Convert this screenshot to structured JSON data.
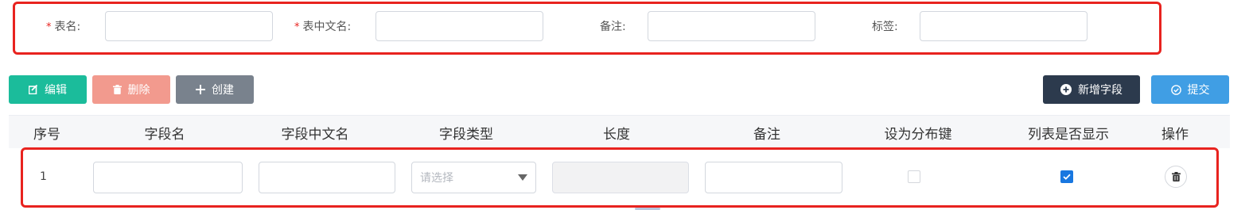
{
  "form": {
    "table_name_label": "表名:",
    "table_cn_name_label": "表中文名:",
    "remark_label": "备注:",
    "tag_label": "标签:",
    "required_mark": "*",
    "table_name_value": "",
    "table_cn_name_value": "",
    "remark_value": "",
    "tag_value": ""
  },
  "toolbar": {
    "edit_label": "编辑",
    "delete_label": "删除",
    "create_label": "创建",
    "add_field_label": "新增字段",
    "submit_label": "提交"
  },
  "table": {
    "columns": [
      "序号",
      "字段名",
      "字段中文名",
      "字段类型",
      "长度",
      "备注",
      "设为分布键",
      "列表是否显示",
      "操作"
    ],
    "rows": [
      {
        "index": "1",
        "field_name": "",
        "field_cn_name": "",
        "field_type_placeholder": "请选择",
        "length": "",
        "remark": "",
        "distribution_key": false,
        "show_in_list": true
      }
    ]
  },
  "colors": {
    "highlight_border": "#e8231f",
    "edit": "#1bbc9b",
    "delete": "#f29a8e",
    "create": "#79828d",
    "add_field": "#2c3a4d",
    "submit": "#409ee4",
    "checkbox_checked": "#1877e0"
  }
}
